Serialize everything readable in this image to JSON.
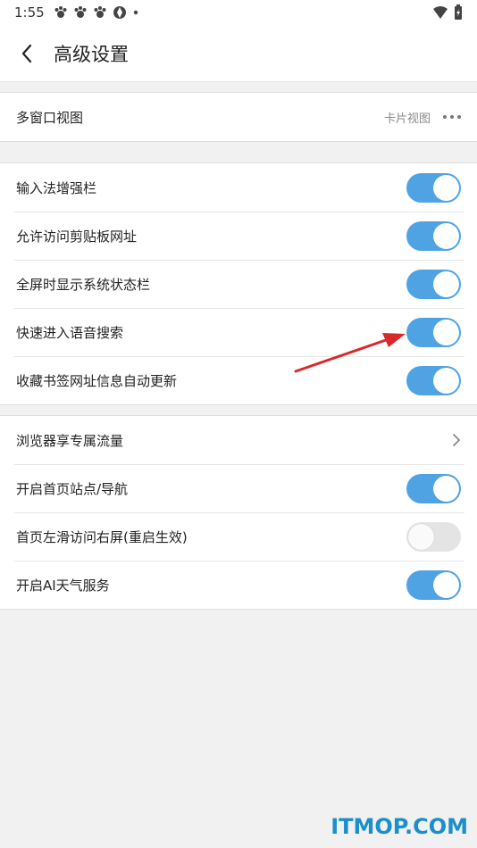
{
  "status_bar": {
    "time": "1:55",
    "icons": [
      "paw-icon",
      "paw-icon",
      "paw-icon",
      "aperture-icon",
      "dot-icon"
    ],
    "right_icons": [
      "wifi-icon",
      "battery-icon"
    ]
  },
  "header": {
    "title": "高级设置"
  },
  "groups": [
    {
      "rows": [
        {
          "label": "多窗口视图",
          "value": "卡片视图",
          "control": "more"
        }
      ]
    },
    {
      "rows": [
        {
          "label": "输入法增强栏",
          "control": "toggle",
          "on": true
        },
        {
          "label": "允许访问剪贴板网址",
          "control": "toggle",
          "on": true
        },
        {
          "label": "全屏时显示系统状态栏",
          "control": "toggle",
          "on": true
        },
        {
          "label": "快速进入语音搜索",
          "control": "toggle",
          "on": true
        },
        {
          "label": "收藏书签网址信息自动更新",
          "control": "toggle",
          "on": true
        }
      ]
    },
    {
      "rows": [
        {
          "label": "浏览器享专属流量",
          "control": "chevron"
        },
        {
          "label": "开启首页站点/导航",
          "control": "toggle",
          "on": true
        },
        {
          "label": "首页左滑访问右屏(重启生效)",
          "control": "toggle",
          "on": false
        },
        {
          "label": "开启AI天气服务",
          "control": "toggle",
          "on": true
        }
      ]
    }
  ],
  "colors": {
    "accent": "#4fa3e3",
    "toggle_off": "#e4e4e4",
    "arrow": "#d9282b",
    "watermark": "#1b8fc9"
  },
  "watermark": "ITMOP.COM"
}
